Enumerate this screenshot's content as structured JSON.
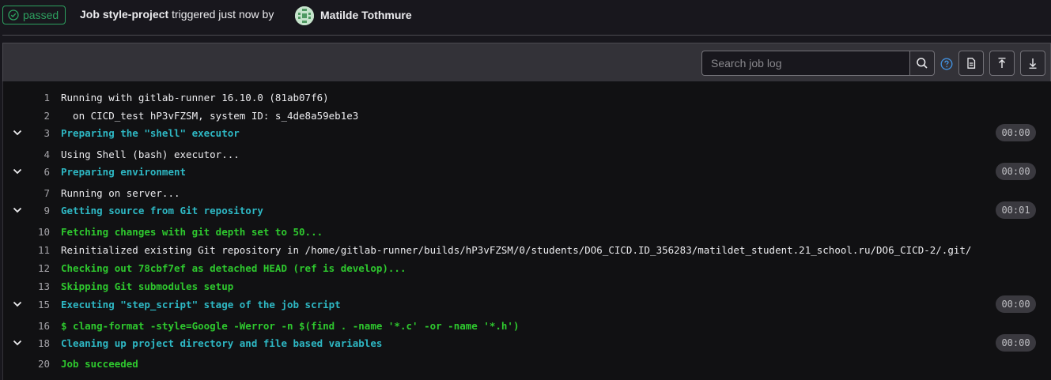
{
  "header": {
    "status": "passed",
    "job_prefix": "Job",
    "job_name": "style-project",
    "triggered_text": "triggered just now by",
    "user": "Matilde Tothmure"
  },
  "toolbar": {
    "search_placeholder": "Search job log"
  },
  "log": [
    {
      "num": "1",
      "text": "Running with gitlab-runner 16.10.0 (81ab07f6)",
      "style": "white",
      "section": false
    },
    {
      "num": "2",
      "text": "  on CICD_test hP3vFZSM, system ID: s_4de8a59eb1e3",
      "style": "white",
      "section": false
    },
    {
      "num": "3",
      "text": "Preparing the \"shell\" executor",
      "style": "cyan",
      "section": true,
      "duration": "00:00"
    },
    {
      "num": "4",
      "text": "Using Shell (bash) executor...",
      "style": "white",
      "section": false
    },
    {
      "num": "6",
      "text": "Preparing environment",
      "style": "cyan",
      "section": true,
      "duration": "00:00"
    },
    {
      "num": "7",
      "text": "Running on server...",
      "style": "white",
      "section": false
    },
    {
      "num": "9",
      "text": "Getting source from Git repository",
      "style": "cyan",
      "section": true,
      "duration": "00:01"
    },
    {
      "num": "10",
      "text": "Fetching changes with git depth set to 50...",
      "style": "green",
      "section": false
    },
    {
      "num": "11",
      "text": "Reinitialized existing Git repository in /home/gitlab-runner/builds/hP3vFZSM/0/students/DO6_CICD.ID_356283/matildet_student.21_school.ru/DO6_CICD-2/.git/",
      "style": "white",
      "section": false
    },
    {
      "num": "12",
      "text": "Checking out 78cbf7ef as detached HEAD (ref is develop)...",
      "style": "green",
      "section": false
    },
    {
      "num": "13",
      "text": "Skipping Git submodules setup",
      "style": "green",
      "section": false
    },
    {
      "num": "15",
      "text": "Executing \"step_script\" stage of the job script",
      "style": "cyan",
      "section": true,
      "duration": "00:00"
    },
    {
      "num": "16",
      "text": "$ clang-format -style=Google -Werror -n $(find . -name '*.c' -or -name '*.h')",
      "style": "green",
      "section": false
    },
    {
      "num": "18",
      "text": "Cleaning up project directory and file based variables",
      "style": "cyan",
      "section": true,
      "duration": "00:00"
    },
    {
      "num": "20",
      "text": "Job succeeded",
      "style": "green",
      "section": false
    }
  ]
}
